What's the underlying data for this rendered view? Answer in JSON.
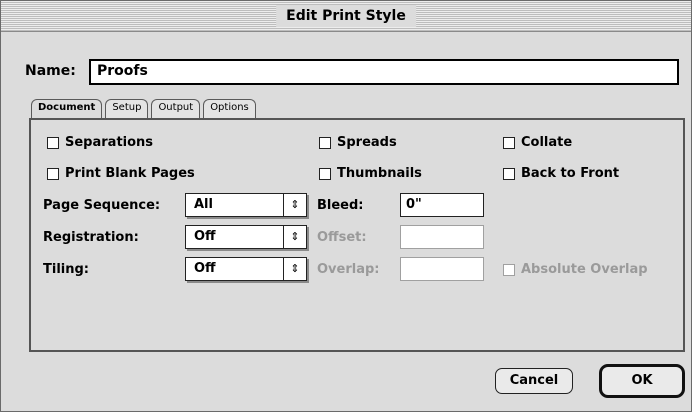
{
  "window": {
    "title": "Edit Print Style"
  },
  "name": {
    "label": "Name:",
    "value": "Proofs"
  },
  "tabs": [
    "Document",
    "Setup",
    "Output",
    "Options"
  ],
  "options": {
    "separations": {
      "label": "Separations",
      "checked": false
    },
    "spreads": {
      "label": "Spreads",
      "checked": false
    },
    "collate": {
      "label": "Collate",
      "checked": false
    },
    "print_blank_pages": {
      "label": "Print Blank Pages",
      "checked": false
    },
    "thumbnails": {
      "label": "Thumbnails",
      "checked": false
    },
    "back_to_front": {
      "label": "Back to Front",
      "checked": false
    },
    "absolute_overlap": {
      "label": "Absolute Overlap",
      "checked": false,
      "enabled": false
    }
  },
  "fields": {
    "page_sequence": {
      "label": "Page Sequence:",
      "value": "All"
    },
    "registration": {
      "label": "Registration:",
      "value": "Off"
    },
    "tiling": {
      "label": "Tiling:",
      "value": "Off"
    },
    "bleed": {
      "label": "Bleed:",
      "value": "0\""
    },
    "offset": {
      "label": "Offset:",
      "value": "",
      "enabled": false
    },
    "overlap": {
      "label": "Overlap:",
      "value": "",
      "enabled": false
    }
  },
  "buttons": {
    "cancel": "Cancel",
    "ok": "OK"
  }
}
